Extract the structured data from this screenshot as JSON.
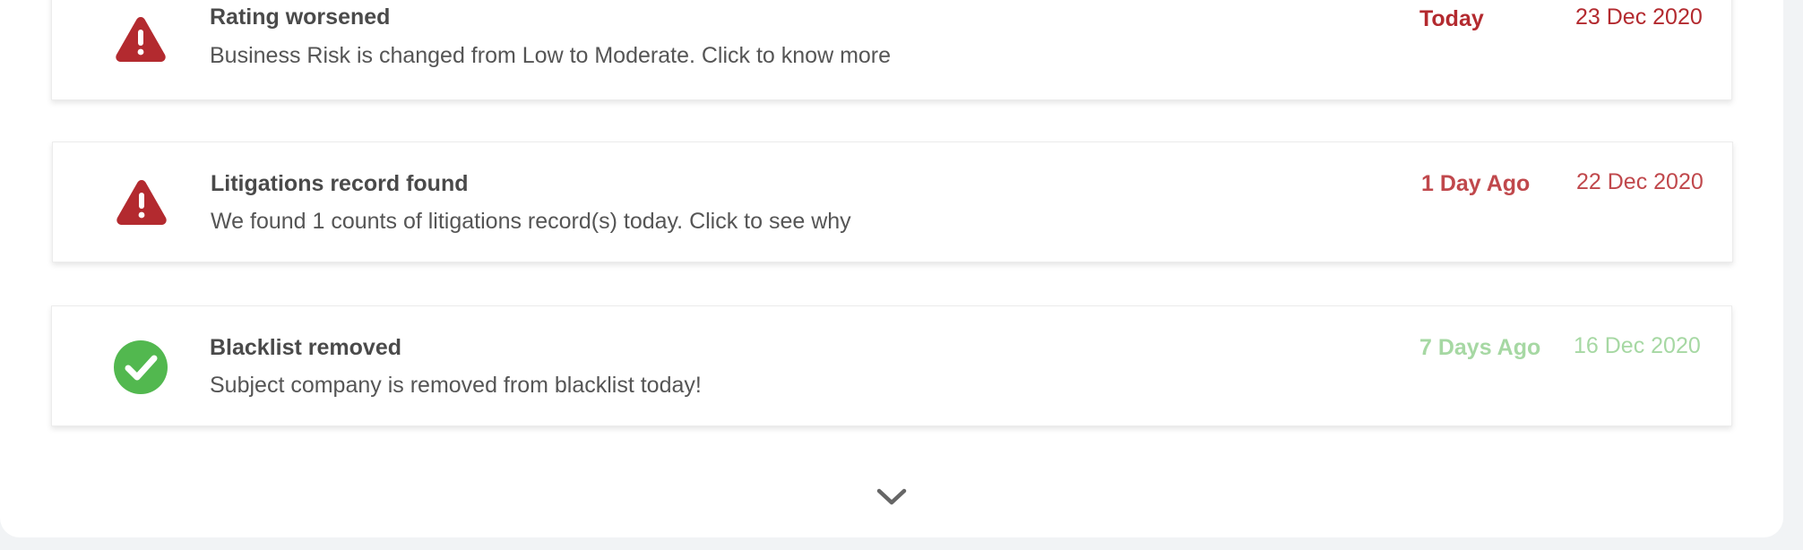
{
  "colors": {
    "danger": "#b32a2f",
    "danger_light": "#c0484c",
    "success": "#52b84f",
    "success_text": "#9fd49b"
  },
  "alerts": [
    {
      "icon": "warning-icon",
      "title": "Rating worsened",
      "description": "Business Risk is changed from Low to Moderate.  Click to know more",
      "ago": "Today",
      "date": "23 Dec 2020",
      "ago_color": "#b32a2f",
      "date_color": "#b32a2f"
    },
    {
      "icon": "warning-icon",
      "title": "Litigations record found",
      "description": "We found 1 counts of litigations record(s) today.  Click to see why",
      "ago": "1 Day Ago",
      "date": "22 Dec 2020",
      "ago_color": "#c0484c",
      "date_color": "#c0484c"
    },
    {
      "icon": "check-circle-icon",
      "title": "Blacklist removed",
      "description": "Subject company is removed from blacklist today!",
      "ago": "7 Days Ago",
      "date": "16 Dec 2020",
      "ago_color": "#a6d8a3",
      "date_color": "#a6d8a3"
    }
  ],
  "expand": {
    "icon": "chevron-down-icon"
  }
}
